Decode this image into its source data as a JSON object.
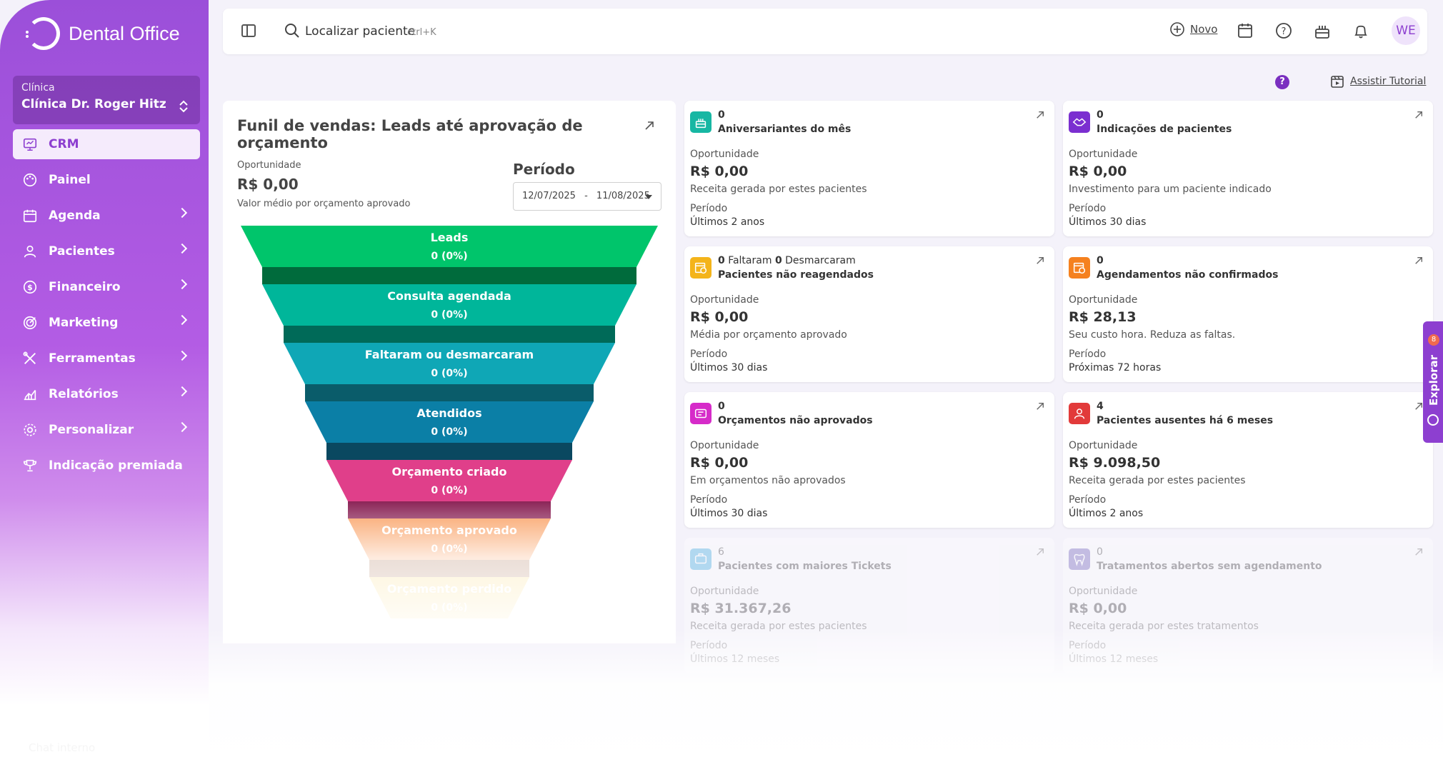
{
  "app": {
    "name": "Dental Office"
  },
  "clinic": {
    "label": "Clínica",
    "name": "Clínica Dr. Roger Hitz"
  },
  "nav": [
    {
      "label": "CRM",
      "icon": "crm-icon",
      "active": true,
      "chevron": false
    },
    {
      "label": "Painel",
      "icon": "palette-icon",
      "chevron": false
    },
    {
      "label": "Agenda",
      "icon": "calendar-icon",
      "chevron": true
    },
    {
      "label": "Pacientes",
      "icon": "user-icon",
      "chevron": true
    },
    {
      "label": "Financeiro",
      "icon": "dollar-icon",
      "chevron": true
    },
    {
      "label": "Marketing",
      "icon": "target-icon",
      "chevron": true
    },
    {
      "label": "Ferramentas",
      "icon": "tools-icon",
      "chevron": true
    },
    {
      "label": "Relatórios",
      "icon": "chart-icon",
      "chevron": true
    },
    {
      "label": "Personalizar",
      "icon": "gear-icon",
      "chevron": true
    },
    {
      "label": "Indicação premiada",
      "icon": "trophy-icon",
      "chevron": false
    }
  ],
  "chat": {
    "label": "Chat interno"
  },
  "topbar": {
    "search_text": "Localizar paciente",
    "search_shortcut": "ctrl+K",
    "new_label": "Novo",
    "avatar_initials": "WE"
  },
  "subheader": {
    "tutorial_label": "Assistir Tutorial",
    "help_glyph": "?"
  },
  "funnel": {
    "title": "Funil de vendas: Leads até aprovação de orçamento",
    "opportunity_label": "Oportunidade",
    "opportunity_value": "R$ 0,00",
    "opportunity_desc": "Valor médio por orçamento aprovado",
    "period_label": "Período",
    "period_start": "12/07/2025",
    "period_sep": "-",
    "period_end": "11/08/2025",
    "stages": [
      {
        "label": "Leads",
        "value": "0 (0%)",
        "color": "#00c56b",
        "shadow": "#006b3c"
      },
      {
        "label": "Consulta agendada",
        "value": "0 (0%)",
        "color": "#00b69a",
        "shadow": "#006a58"
      },
      {
        "label": "Faltaram ou desmarcaram",
        "value": "0 (0%)",
        "color": "#0fa7b6",
        "shadow": "#0a5c6a"
      },
      {
        "label": "Atendidos",
        "value": "0 (0%)",
        "color": "#0b7fa6",
        "shadow": "#0a4860"
      },
      {
        "label": "Orçamento criado",
        "value": "0 (0%)",
        "color": "#e03f8a",
        "shadow": "#8a2356"
      },
      {
        "label": "Orçamento aprovado",
        "value": "0 (0%)",
        "color": "#f99a5a",
        "shadow": "#9a5a36"
      },
      {
        "label": "Orçamento perdido",
        "value": "0 (0%)",
        "color": "#f9cf56",
        "shadow": "#a08a3a"
      }
    ]
  },
  "cards": [
    {
      "count_parts": [
        {
          "b": "0"
        }
      ],
      "title": "Aniversariantes do mês",
      "opp_label": "Oportunidade",
      "value": "R$ 0,00",
      "desc": "Receita gerada por estes pacientes",
      "period_label": "Período",
      "period": "Últimos 2 anos",
      "icon": "cake-icon",
      "color": "#17b7a3"
    },
    {
      "count_parts": [
        {
          "b": "0"
        }
      ],
      "title": "Indicações de pacientes",
      "opp_label": "Oportunidade",
      "value": "R$ 0,00",
      "desc": "Investimento para um paciente indicado",
      "period_label": "Período",
      "period": "Últimos 30 dias",
      "icon": "handshake-icon",
      "color": "#7b2fd0"
    },
    {
      "count_parts": [
        {
          "b": "0"
        },
        {
          "t": " Faltaram "
        },
        {
          "b": "0"
        },
        {
          "t": " Desmarcaram"
        }
      ],
      "title": "Pacientes não reagendados",
      "opp_label": "Oportunidade",
      "value": "R$ 0,00",
      "desc": "Média por orçamento aprovado",
      "period_label": "Período",
      "period": "Últimos 30 dias",
      "icon": "calendar-clock-icon",
      "color": "#f4b41a"
    },
    {
      "count_parts": [
        {
          "b": "0"
        }
      ],
      "title": "Agendamentos não confirmados",
      "opp_label": "Oportunidade",
      "value": "R$ 28,13",
      "desc": "Seu custo hora. Reduza as faltas.",
      "period_label": "Período",
      "period": "Próximas 72 horas",
      "icon": "calendar-alert-icon",
      "color": "#f5811f"
    },
    {
      "count_parts": [
        {
          "b": "0"
        }
      ],
      "title": "Orçamentos não aprovados",
      "opp_label": "Oportunidade",
      "value": "R$ 0,00",
      "desc": "Em orçamentos não aprovados",
      "period_label": "Período",
      "period": "Últimos 30 dias",
      "icon": "invoice-icon",
      "color": "#d62bc9"
    },
    {
      "count_parts": [
        {
          "b": "4"
        }
      ],
      "title": "Pacientes ausentes há 6 meses",
      "opp_label": "Oportunidade",
      "value": "R$ 9.098,50",
      "desc": "Receita gerada por estes pacientes",
      "period_label": "Período",
      "period": "Últimos 2 anos",
      "icon": "user-absent-icon",
      "color": "#e23a3a"
    },
    {
      "count_parts": [
        {
          "t": "6"
        }
      ],
      "title": "Pacientes com maiores Tickets",
      "opp_label": "Oportunidade",
      "value": "R$ 31.367,26",
      "desc": "Receita gerada por estes pacientes",
      "period_label": "Período",
      "period": "Últimos 12 meses",
      "icon": "ticket-icon",
      "color": "#38a9e0",
      "faded": true
    },
    {
      "count_parts": [
        {
          "t": "0"
        }
      ],
      "title": "Tratamentos abertos sem agendamento",
      "opp_label": "Oportunidade",
      "value": "R$ 0,00",
      "desc": "Receita gerada por estes tratamentos",
      "period_label": "Período",
      "period": "Últimos 12 meses",
      "icon": "tooth-icon",
      "color": "#6b5bb7",
      "faded": true
    }
  ],
  "explore": {
    "label": "Explorar",
    "badge": "8"
  }
}
